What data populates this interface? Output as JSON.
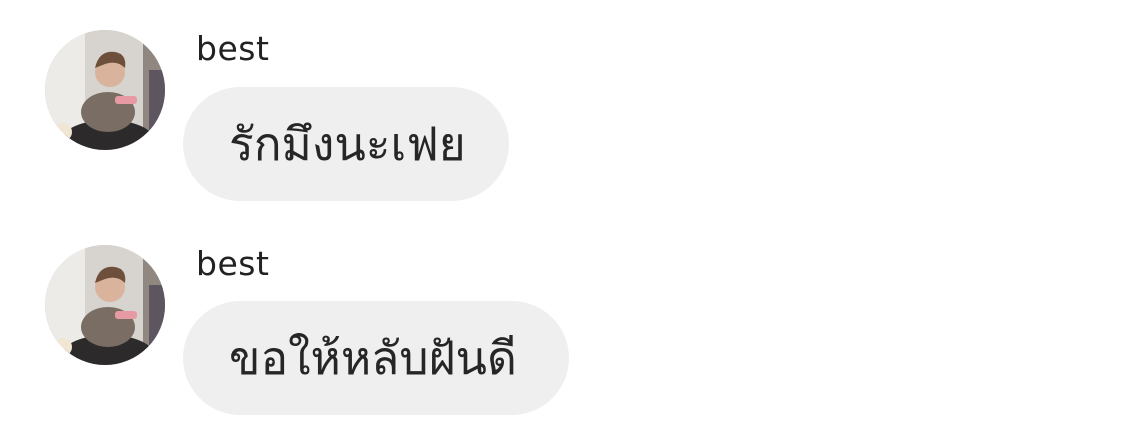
{
  "messages": [
    {
      "sender": "best",
      "text": "รักมึงนะเฟย",
      "avatar_icon": "user-avatar-icon"
    },
    {
      "sender": "best",
      "text": "ขอให้หลับฝันดี",
      "avatar_icon": "user-avatar-icon"
    }
  ],
  "colors": {
    "background": "#ffffff",
    "bubble": "#efefef",
    "text": "#262626"
  }
}
